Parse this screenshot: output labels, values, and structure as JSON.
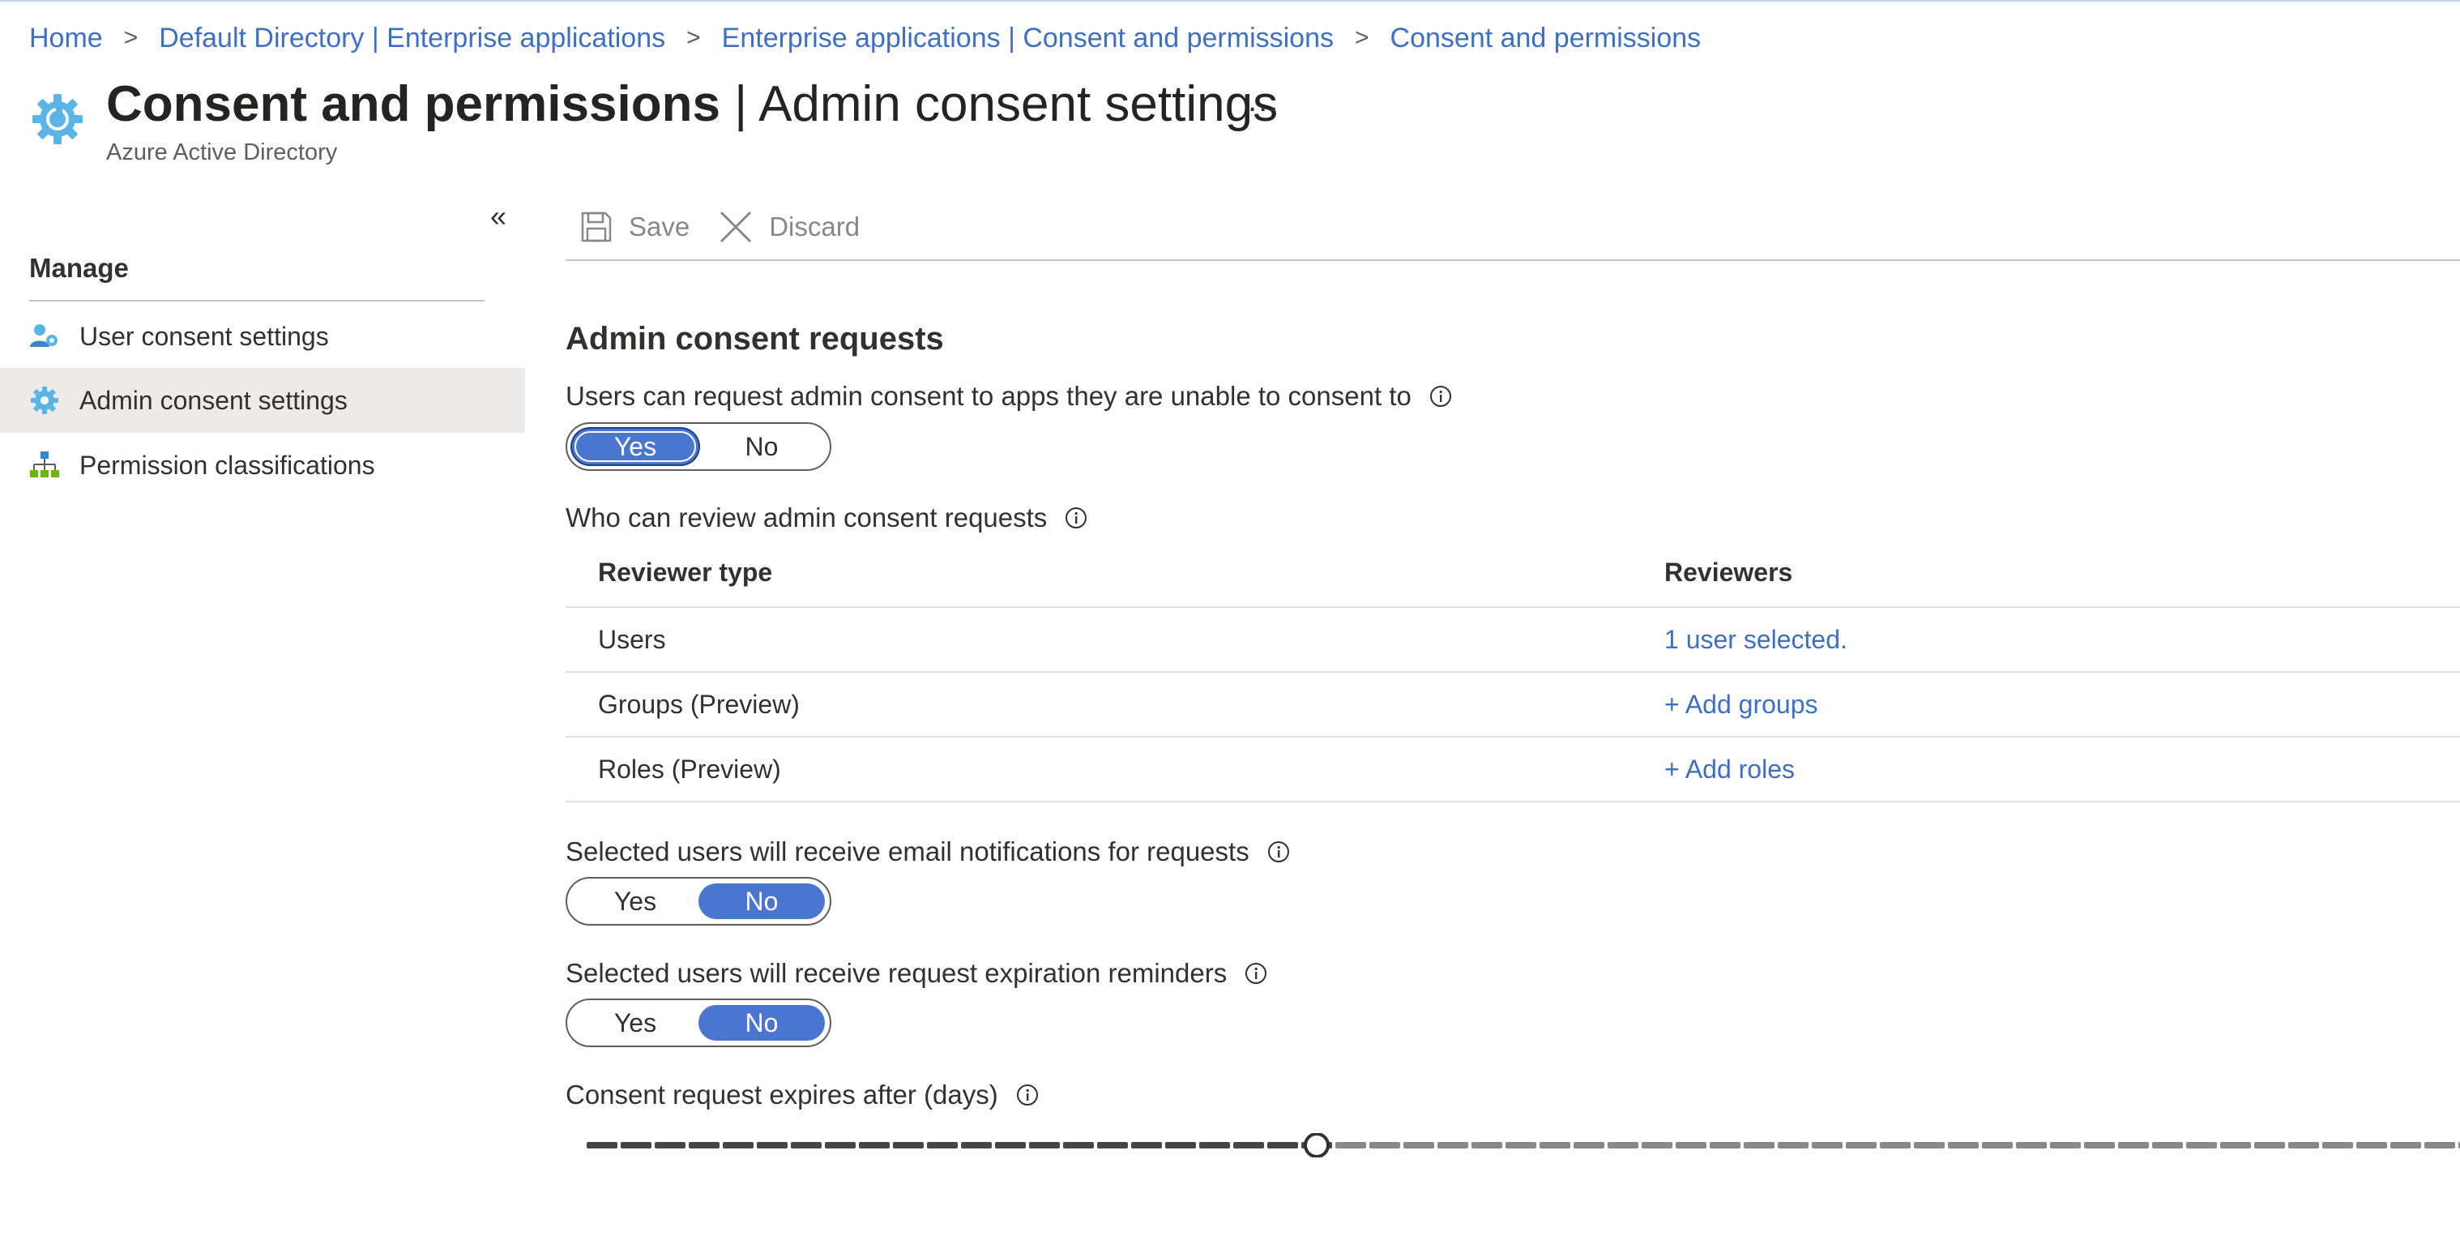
{
  "breadcrumb": [
    {
      "label": "Home"
    },
    {
      "label": "Default Directory | Enterprise applications"
    },
    {
      "label": "Enterprise applications | Consent and permissions"
    },
    {
      "label": "Consent and permissions"
    }
  ],
  "breadcrumb_separator": ">",
  "header": {
    "title_main": "Consent and permissions",
    "title_separator": " | ",
    "title_section": "Admin consent settings",
    "more_label": "...",
    "subtitle": "Azure Active Directory",
    "icon": "gear-refresh-icon"
  },
  "sidebar": {
    "collapse_label": "«",
    "section_label": "Manage",
    "items": [
      {
        "label": "User consent settings",
        "icon": "user-gear-icon",
        "active": false
      },
      {
        "label": "Admin consent settings",
        "icon": "gear-icon",
        "active": true
      },
      {
        "label": "Permission classifications",
        "icon": "hierarchy-icon",
        "active": false
      }
    ]
  },
  "toolbar": {
    "save_label": "Save",
    "discard_label": "Discard"
  },
  "main": {
    "section_title": "Admin consent requests",
    "request_label": "Users can request admin consent to apps they are unable to consent to",
    "request_toggle": {
      "yes": "Yes",
      "no": "No",
      "selected": "Yes"
    },
    "reviewers_label": "Who can review admin consent requests",
    "table": {
      "columns": [
        "Reviewer type",
        "Reviewers"
      ],
      "rows": [
        {
          "type": "Users",
          "reviewers": "1 user selected."
        },
        {
          "type": "Groups (Preview)",
          "reviewers": "+ Add groups"
        },
        {
          "type": "Roles (Preview)",
          "reviewers": "+ Add roles"
        }
      ]
    },
    "email_label": "Selected users will receive email notifications for requests",
    "email_toggle": {
      "yes": "Yes",
      "no": "No",
      "selected": "No"
    },
    "reminder_label": "Selected users will receive request expiration reminders",
    "reminder_toggle": {
      "yes": "Yes",
      "no": "No",
      "selected": "No"
    },
    "expires_label": "Consent request expires after (days)",
    "expires_slider": {
      "fraction": 0.41
    }
  },
  "colors": {
    "accent": "#4a76cf",
    "link": "#3d6fc4",
    "text": "#323130",
    "icon_blue": "#5ab4e6"
  }
}
